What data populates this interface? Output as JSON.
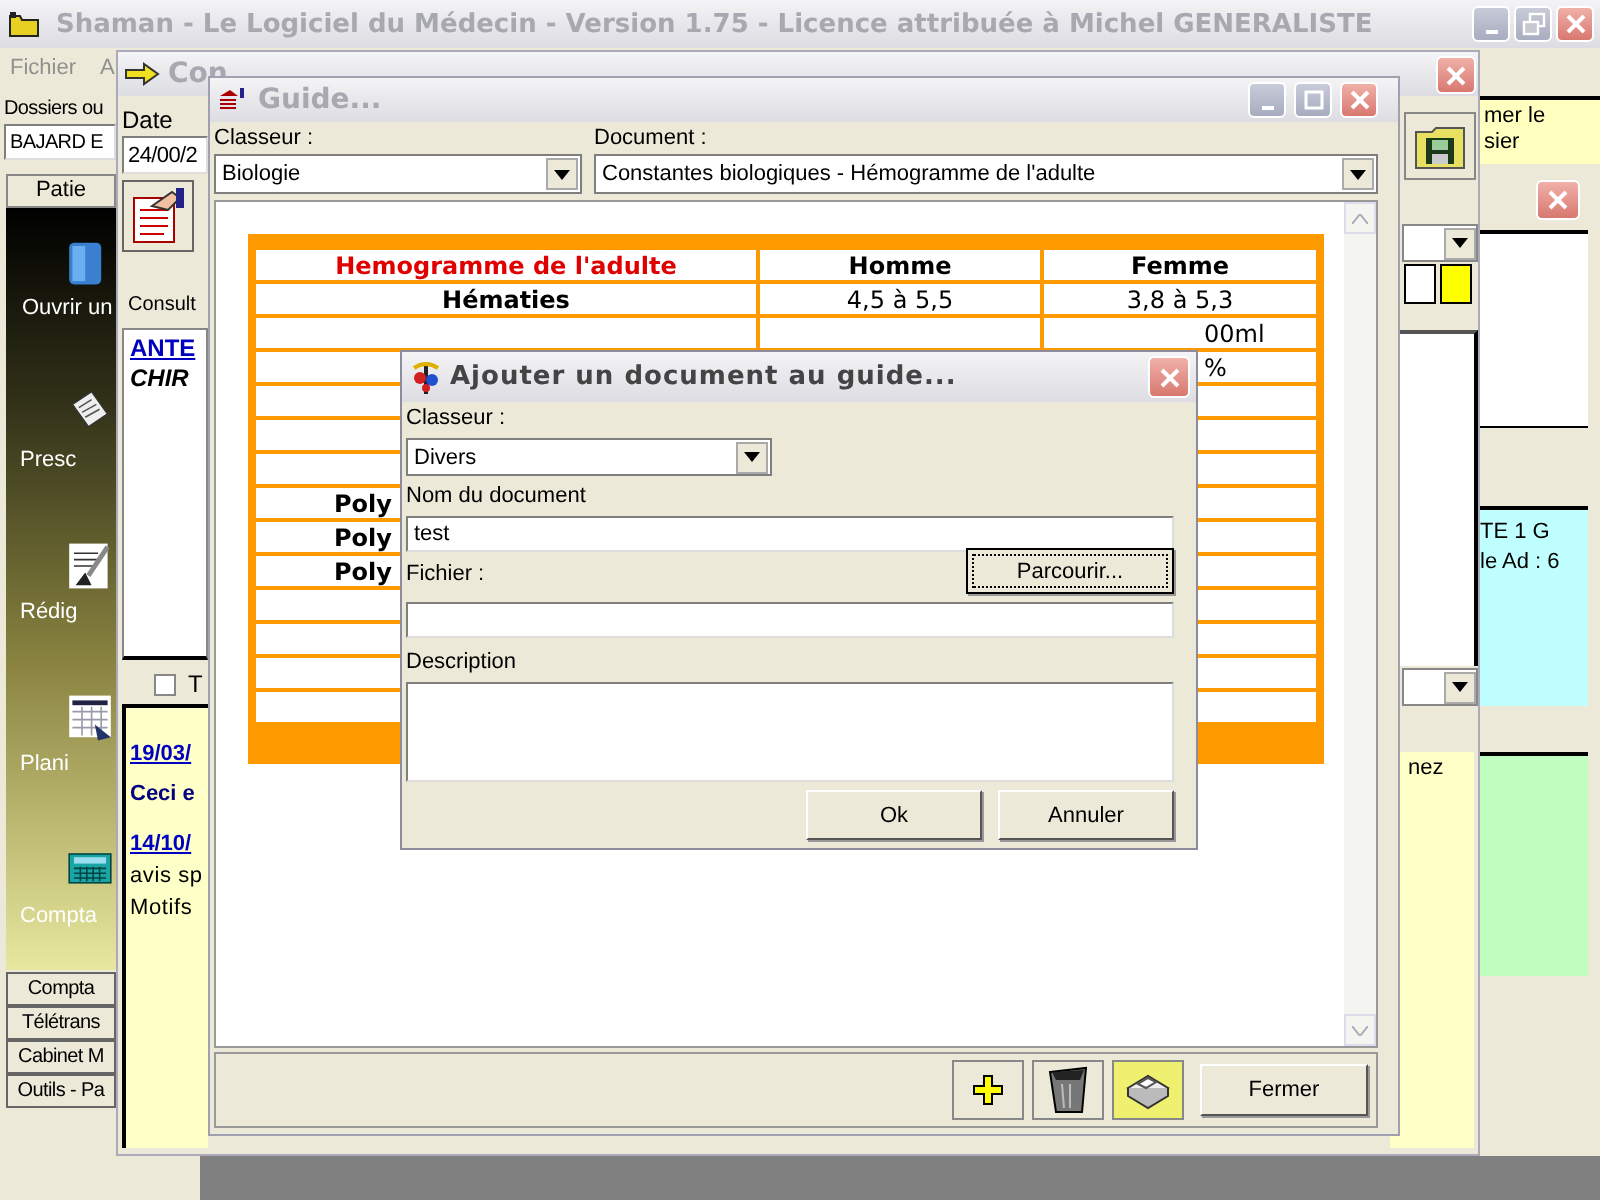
{
  "main_window": {
    "title": "Shaman - Le Logiciel du Médecin - Version 1.75 - Licence attribuée à Michel GENERALISTE",
    "menu": [
      "Fichier",
      "A"
    ],
    "search_label": "Dossiers ou",
    "search_value": "BAJARD E",
    "sidebar_header": "Patie",
    "sidebar_items": [
      {
        "kind": "folder",
        "label": "Ouvrir un"
      },
      {
        "kind": "prescription",
        "label": "Presc"
      },
      {
        "kind": "letter",
        "label": "Rédig"
      },
      {
        "kind": "calendar",
        "label": "Plani"
      },
      {
        "kind": "calculator",
        "label": "Compta"
      }
    ],
    "bottom_tabs": [
      "Compta",
      "Télétrans",
      "Cabinet M",
      "Outils - Pa"
    ],
    "note_lines": [
      "mer le",
      "sier"
    ]
  },
  "consultation_window": {
    "title": "Con",
    "date_label": "Date",
    "date_value": "24/00/2",
    "tab": "Consult",
    "history": [
      {
        "kind": "link",
        "text": "ANTE"
      },
      {
        "kind": "italic",
        "text": "CHIR"
      }
    ],
    "checkbox": {
      "label": "T",
      "checked": false
    },
    "notes": [
      {
        "kind": "link",
        "text": "19/03/"
      },
      {
        "kind": "bold",
        "text": "Ceci e"
      },
      {
        "kind": "link",
        "text": "14/10/"
      },
      {
        "kind": "plain",
        "text": "avis sp"
      },
      {
        "kind": "plain",
        "text": "Motifs"
      }
    ],
    "swatches": [
      {
        "color": "#ffffff"
      },
      {
        "color": "#ffff00"
      }
    ],
    "side_text": "nez"
  },
  "side_window": {
    "lines": [
      "TE 1 G",
      "le Ad : 6"
    ]
  },
  "guide_window": {
    "title": "Guide...",
    "classeur_label": "Classeur :",
    "classeur_value": "Biologie",
    "document_label": "Document :",
    "document_value": "Constantes biologiques - Hémogramme de l'adulte",
    "table": {
      "columns": [
        "Hemogramme de l'adulte",
        "Homme",
        "Femme"
      ],
      "rows": [
        {
          "kind": "full",
          "cells": [
            "Hématies",
            "4,5 à 5,5",
            "3,8 à 5,3"
          ]
        },
        {
          "kind": "cut",
          "femme": "00ml"
        },
        {
          "kind": "cut",
          "femme": "%"
        },
        {
          "kind": "cut"
        },
        {
          "kind": "cut"
        },
        {
          "kind": "cut"
        },
        {
          "kind": "cut",
          "label": "Poly"
        },
        {
          "kind": "cut",
          "label": "Poly"
        },
        {
          "kind": "cut",
          "label": "Poly"
        },
        {
          "kind": "cut"
        },
        {
          "kind": "cut"
        },
        {
          "kind": "cut"
        },
        {
          "kind": "cut"
        }
      ]
    },
    "close_button": "Fermer"
  },
  "add_dialog": {
    "title": "Ajouter un document au guide...",
    "classeur_label": "Classeur :",
    "classeur_value": "Divers",
    "name_label": "Nom du document",
    "name_value": "test",
    "file_label": "Fichier :",
    "browse_button": "Parcourir...",
    "description_label": "Description",
    "ok_button": "Ok",
    "cancel_button": "Annuler"
  }
}
